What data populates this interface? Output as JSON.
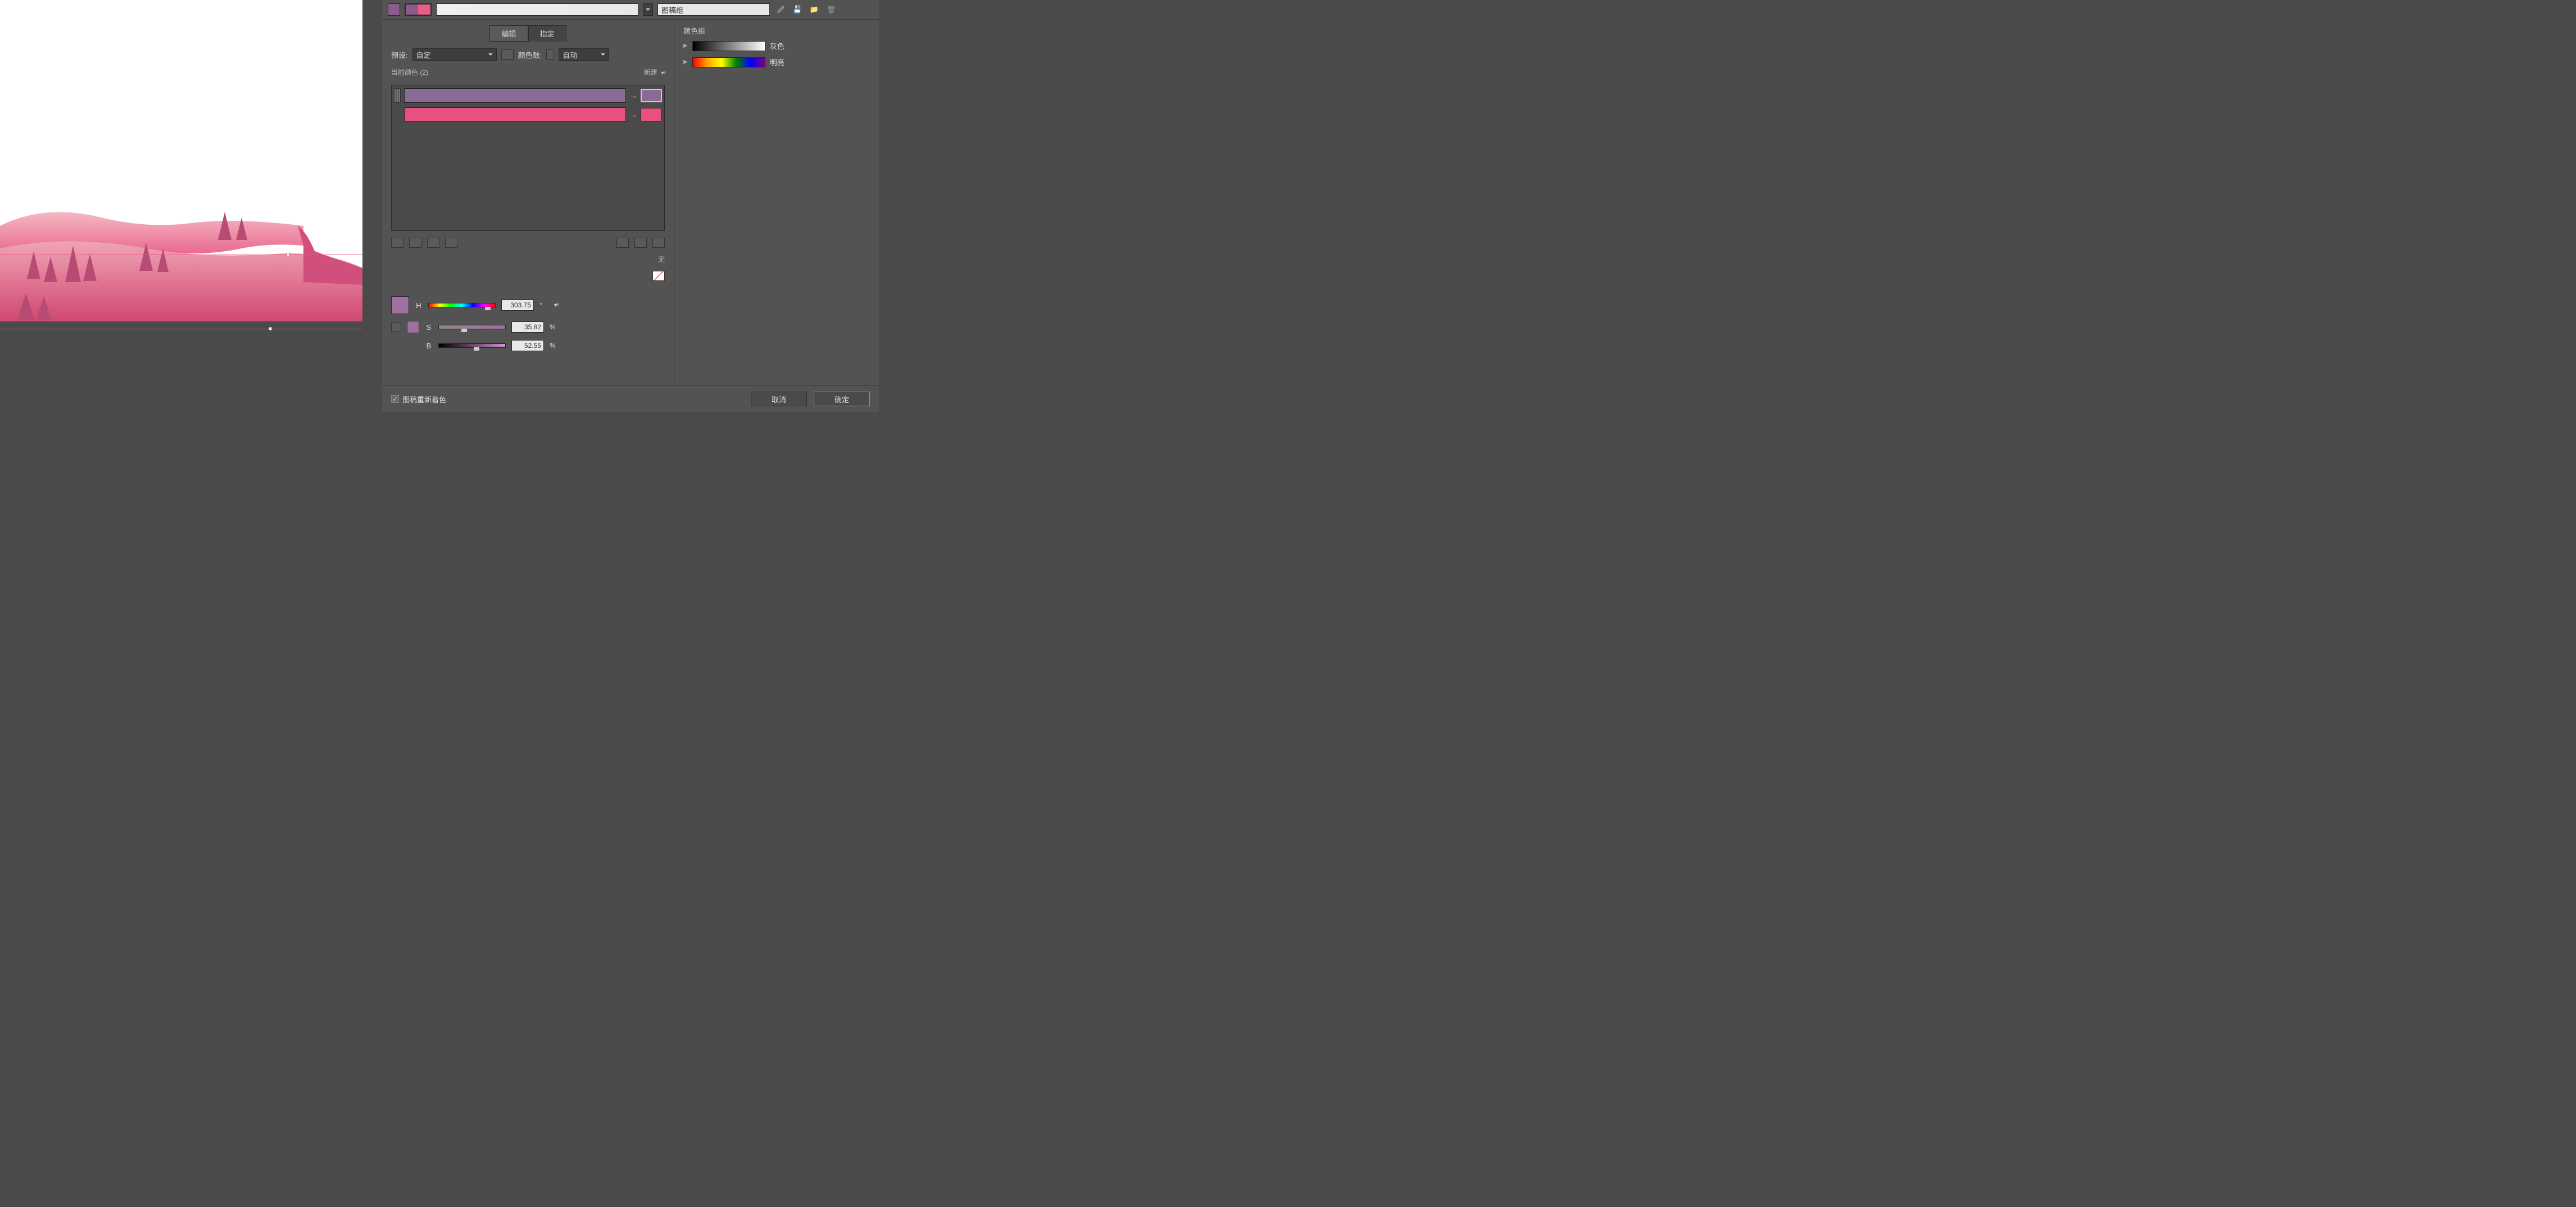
{
  "topbar": {
    "swatch_color": "#8a5c8a",
    "split_left": "#8a5c8a",
    "split_right": "#e85d8a",
    "group_name_value": "图稿组"
  },
  "tabs": {
    "edit": "编辑",
    "assign": "指定"
  },
  "preset": {
    "label": "预设:",
    "value": "自定",
    "color_count_label": "颜色数:",
    "color_count_value": "自动"
  },
  "current_colors": {
    "label": "当前颜色 (2)",
    "new_label": "新建",
    "rows": [
      {
        "color": "#8a6a96",
        "target": "#8a6a96"
      },
      {
        "color": "#e8517f",
        "target": "#e8517f"
      }
    ]
  },
  "none_label": "无",
  "hsb": {
    "swatch_large": "#a070a0",
    "swatch_small": "#a070a0",
    "h_label": "H",
    "h_value": "303.75",
    "h_unit": "°",
    "s_label": "S",
    "s_value": "35.82",
    "s_unit": "%",
    "b_label": "B",
    "b_value": "52.55",
    "b_unit": "%"
  },
  "color_groups": {
    "heading": "颜色组",
    "groups": [
      {
        "name": "灰色"
      },
      {
        "name": "明亮"
      }
    ]
  },
  "footer": {
    "recolor_label": "图稿重新着色",
    "cancel": "取消",
    "ok": "确定"
  }
}
